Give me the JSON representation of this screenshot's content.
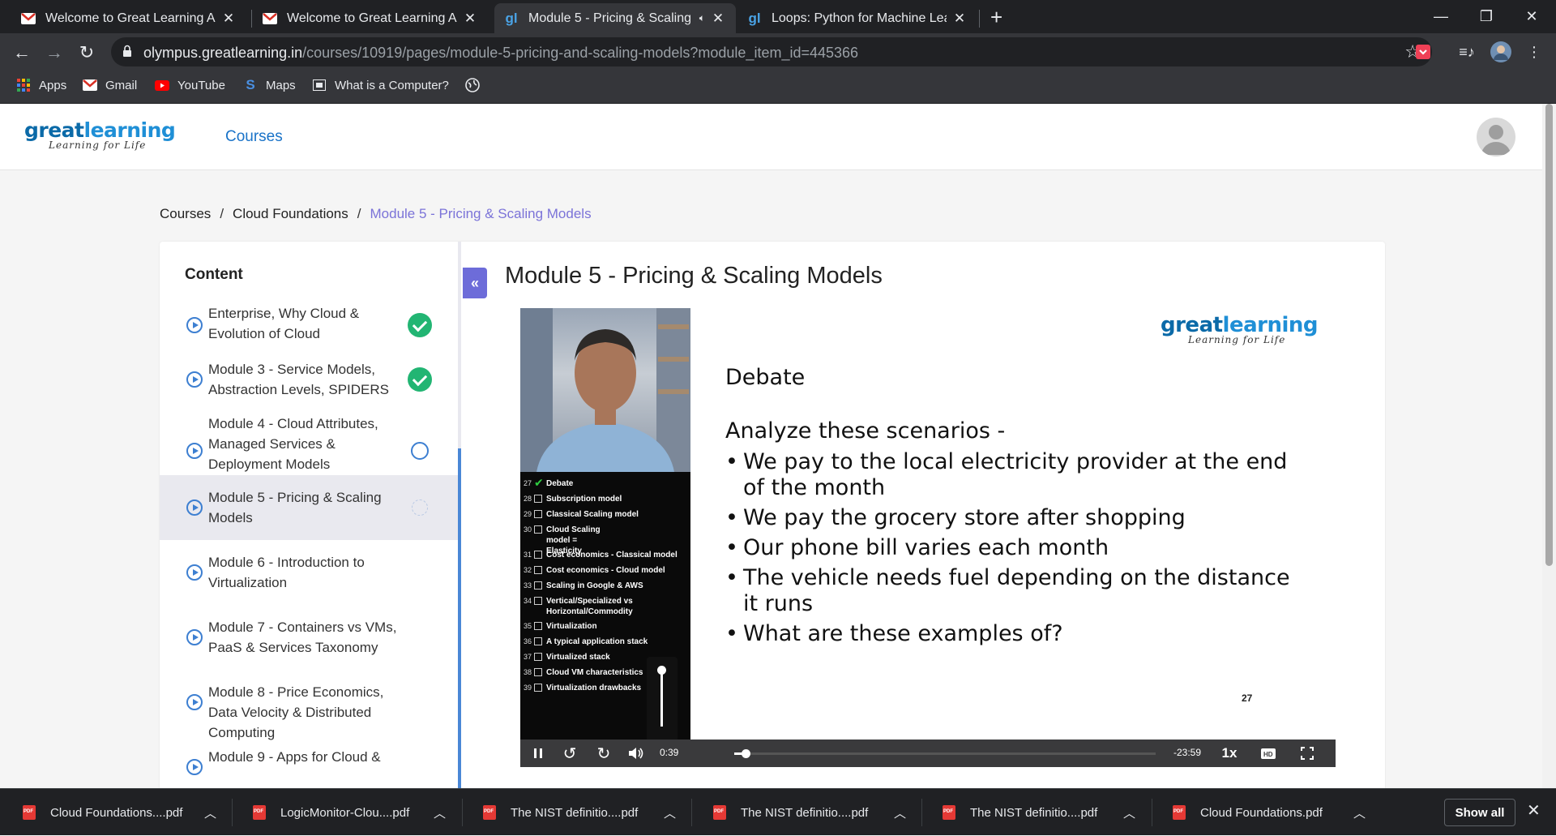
{
  "browser": {
    "tabs": [
      {
        "title": "Welcome to Great Learning Acad",
        "icon": "gmail-icon"
      },
      {
        "title": "Welcome to Great Learning Acad",
        "icon": "gmail-icon"
      },
      {
        "title": "Module 5 - Pricing & Scaling",
        "icon": "greatlearning-icon"
      },
      {
        "title": "Loops: Python for Machine Learn",
        "icon": "greatlearning-icon"
      }
    ],
    "url_host": "olympus.greatlearning.in",
    "url_path": "/courses/10919/pages/module-5-pricing-and-scaling-models?module_item_id=445366",
    "bookmarks": [
      {
        "label": "Apps"
      },
      {
        "label": "Gmail"
      },
      {
        "label": "YouTube"
      },
      {
        "label": "Maps"
      },
      {
        "label": "What is a Computer?"
      }
    ]
  },
  "site": {
    "logo_text_a": "great",
    "logo_text_b": "learning",
    "logo_tagline": "Learning for Life",
    "nav_courses": "Courses"
  },
  "breadcrumb": {
    "items": [
      "Courses",
      "Cloud Foundations",
      "Module 5 - Pricing & Scaling Models"
    ],
    "separator": "/"
  },
  "sidebar": {
    "title": "Content",
    "modules": [
      {
        "label": "Enterprise, Why Cloud & Evolution of Cloud",
        "status": "complete"
      },
      {
        "label": "Module 3 - Service Models, Abstraction Levels, SPIDERS",
        "status": "complete"
      },
      {
        "label": "Module 4 - Cloud Attributes, Managed Services & Deployment Models",
        "status": "not-started"
      },
      {
        "label": "Module 5 - Pricing & Scaling Models",
        "status": "in-progress"
      },
      {
        "label": "Module 6 - Introduction to Virtualization",
        "status": "none"
      },
      {
        "label": "Module 7 - Containers vs VMs, PaaS & Services Taxonomy",
        "status": "none"
      },
      {
        "label": "Module 8 - Price Economics, Data Velocity & Distributed Computing",
        "status": "none"
      },
      {
        "label": "Module 9 - Apps for Cloud &",
        "status": "none"
      }
    ]
  },
  "lesson": {
    "title": "Module 5 - Pricing & Scaling Models"
  },
  "video": {
    "toc": [
      {
        "num": "27",
        "label": "Debate",
        "checked": true
      },
      {
        "num": "28",
        "label": "Subscription model",
        "checked": false
      },
      {
        "num": "29",
        "label": "Classical Scaling model",
        "checked": false
      },
      {
        "num": "30",
        "label": "Cloud Scaling model = Elasticity",
        "checked": false
      },
      {
        "num": "31",
        "label": "Cost economics - Classical model",
        "checked": false
      },
      {
        "num": "32",
        "label": "Cost economics - Cloud model",
        "checked": false
      },
      {
        "num": "33",
        "label": "Scaling in Google & AWS",
        "checked": false
      },
      {
        "num": "34",
        "label": "Vertical/Specialized vs Horizontal/Commodity",
        "checked": false
      },
      {
        "num": "35",
        "label": "Virtualization",
        "checked": false
      },
      {
        "num": "36",
        "label": "A typical application stack",
        "checked": false
      },
      {
        "num": "37",
        "label": "Virtualized stack",
        "checked": false
      },
      {
        "num": "38",
        "label": "Cloud VM characteristics",
        "checked": false
      },
      {
        "num": "39",
        "label": "Virtualization drawbacks",
        "checked": false
      }
    ],
    "slide": {
      "heading": "Debate",
      "intro": "Analyze these scenarios -",
      "bullets": [
        "We pay to the local electricity provider at the end of the month",
        "We pay the grocery store after shopping",
        "Our phone bill varies each month",
        "The vehicle needs fuel depending on the distance it runs",
        "What are these examples of?"
      ],
      "slide_number": "27"
    },
    "elapsed": "0:39",
    "remaining": "-23:59",
    "progress_fraction": 0.027,
    "volume_fraction": 1.0,
    "speed": "1x"
  },
  "downloads": {
    "items": [
      {
        "name": "Cloud Foundations....pdf"
      },
      {
        "name": "LogicMonitor-Clou....pdf"
      },
      {
        "name": "The NIST definitio....pdf"
      },
      {
        "name": "The NIST definitio....pdf"
      },
      {
        "name": "The NIST definitio....pdf"
      },
      {
        "name": "Cloud Foundations.pdf"
      }
    ],
    "show_all": "Show all"
  }
}
